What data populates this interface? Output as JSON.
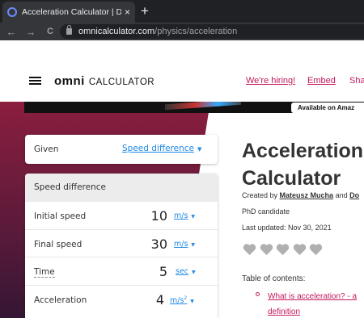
{
  "browser": {
    "tab_title": "Acceleration Calculator | Definitio",
    "tab_close": "×",
    "new_tab": "+",
    "url_host": "omnicalculator.com",
    "url_path": "/physics/acceleration",
    "back": "←",
    "forward": "→",
    "reload": "C"
  },
  "header": {
    "logo_omni": "omni",
    "logo_suffix": "CALCULATOR",
    "links": [
      "We're hiring!",
      "Embed",
      "Sha"
    ]
  },
  "banner": {
    "badge_text": "Available on Amaz"
  },
  "calculator": {
    "given": {
      "label": "Given",
      "value": "Speed difference",
      "caret": "▼"
    },
    "section_title": "Speed difference",
    "rows": [
      {
        "label": "Initial speed",
        "value": "10",
        "unit": "m/s",
        "unit_sup": "",
        "caret": "▼"
      },
      {
        "label": "Final speed",
        "value": "30",
        "unit": "m/s",
        "unit_sup": "",
        "caret": "▼"
      },
      {
        "label": "Time",
        "value": "5",
        "unit": "sec",
        "unit_sup": "",
        "caret": "▼"
      },
      {
        "label": "Acceleration",
        "value": "4",
        "unit": "m/s",
        "unit_sup": "2",
        "caret": "▼"
      }
    ]
  },
  "article": {
    "title_line1": "Acceleration",
    "title_line2": "Calculator",
    "created_by": "Created by",
    "author1": "Mateusz Mucha",
    "and": "and",
    "author2": "Do",
    "author_title": "PhD candidate",
    "last_updated": "Last updated: Nov 30, 2021",
    "rating_hearts": 5,
    "toc_heading": "Table of contents:",
    "toc_item_line1": "What is acceleration? - a",
    "toc_item_line2": "definition"
  },
  "colors": {
    "accent_pink": "#c2185b",
    "link_blue": "#1e88e5",
    "heart_gray": "#b0b0b0"
  }
}
